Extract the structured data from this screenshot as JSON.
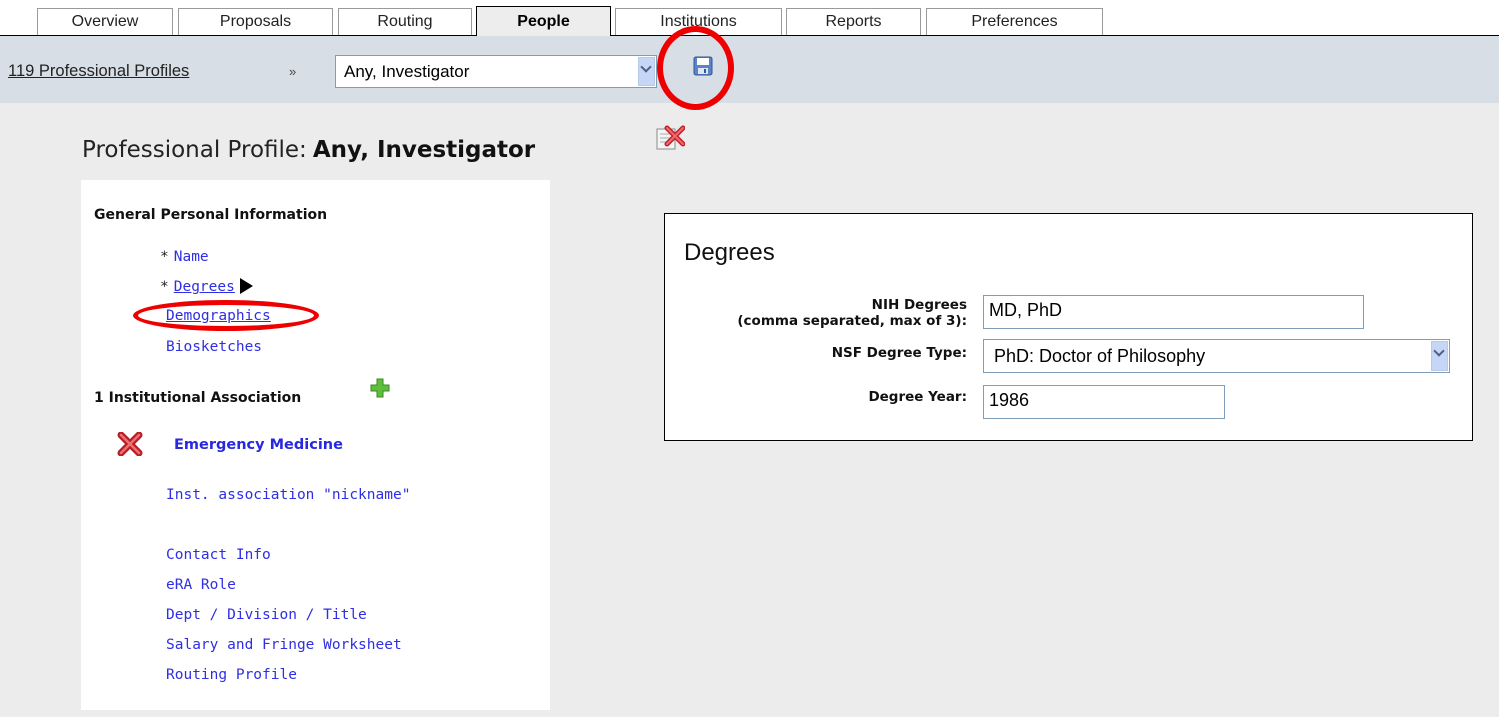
{
  "tabs": [
    {
      "label": "Overview"
    },
    {
      "label": "Proposals"
    },
    {
      "label": "Routing"
    },
    {
      "label": "People",
      "active": true
    },
    {
      "label": "Institutions"
    },
    {
      "label": "Reports"
    },
    {
      "label": "Preferences"
    }
  ],
  "breadcrumb": {
    "link": "119 Professional Profiles",
    "separator": "»",
    "profile_select": "Any, Investigator",
    "save_icon": "save-disk-icon"
  },
  "page": {
    "title_prefix": "Professional Profile:",
    "title_name": "Any, Investigator",
    "delete_icon": "delete-profile-icon"
  },
  "left_nav": {
    "general_heading": "General Personal Information",
    "general_items": [
      {
        "required": "*",
        "label": "Name"
      },
      {
        "required": "*",
        "label": "Degrees",
        "current": true
      },
      {
        "label": "Demographics"
      },
      {
        "label": "Biosketches"
      }
    ],
    "institutional_heading": "1 Institutional Association",
    "add_icon": "plus-icon",
    "institution": {
      "remove_icon": "red-x-icon",
      "name": "Emergency Medicine",
      "nickname": "Inst. association \"nickname\""
    },
    "institution_items": [
      {
        "label": "Contact Info"
      },
      {
        "label": "eRA Role"
      },
      {
        "label": "Dept / Division / Title"
      },
      {
        "label": "Salary and Fringe Worksheet"
      },
      {
        "label": "Routing Profile"
      }
    ]
  },
  "degrees_panel": {
    "title": "Degrees",
    "nih_label_1": "NIH Degrees",
    "nih_label_2": "(comma separated, max of 3):",
    "nih_value": "MD, PhD",
    "nsf_label": "NSF Degree Type:",
    "nsf_value": "PhD: Doctor of Philosophy",
    "year_label": "Degree Year:",
    "year_value": "1986"
  },
  "colors": {
    "link_blue": "#2e2ee5",
    "annotation_red": "#ef0000",
    "crumb_bar": "#d8dee5",
    "content_bg": "#ececec"
  }
}
